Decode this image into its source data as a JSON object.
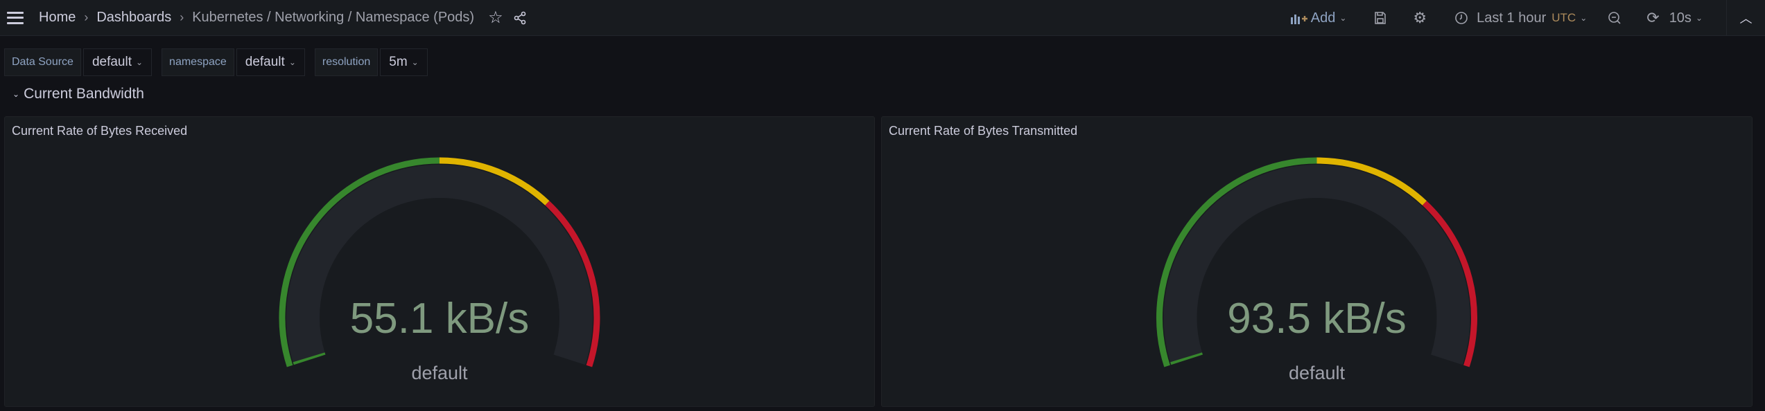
{
  "topbar": {
    "breadcrumbs": [
      "Home",
      "Dashboards",
      "Kubernetes / Networking / Namespace (Pods)"
    ],
    "add_label": "Add",
    "time_range": "Last 1 hour",
    "timezone": "UTC",
    "refresh": "10s"
  },
  "variables": [
    {
      "label": "Data Source",
      "value": "default"
    },
    {
      "label": "namespace",
      "value": "default"
    },
    {
      "label": "resolution",
      "value": "5m"
    }
  ],
  "section": {
    "title": "Current Bandwidth"
  },
  "colors": {
    "green": "#37872d",
    "yellow": "#e0b400",
    "red": "#c4162a",
    "track": "#22252b",
    "value": "#7f9a7f"
  },
  "panels": [
    {
      "title": "Current Rate of Bytes Received",
      "value": "55.1 kB/s",
      "legend": "default",
      "fill_fraction": 0.005,
      "thresholds": [
        {
          "to": 0.5,
          "color": "green"
        },
        {
          "to": 0.7,
          "color": "yellow"
        },
        {
          "to": 1,
          "color": "red"
        }
      ]
    },
    {
      "title": "Current Rate of Bytes Transmitted",
      "value": "93.5 kB/s",
      "legend": "default",
      "fill_fraction": 0.005,
      "thresholds": [
        {
          "to": 0.5,
          "color": "green"
        },
        {
          "to": 0.7,
          "color": "yellow"
        },
        {
          "to": 1,
          "color": "red"
        }
      ]
    }
  ]
}
